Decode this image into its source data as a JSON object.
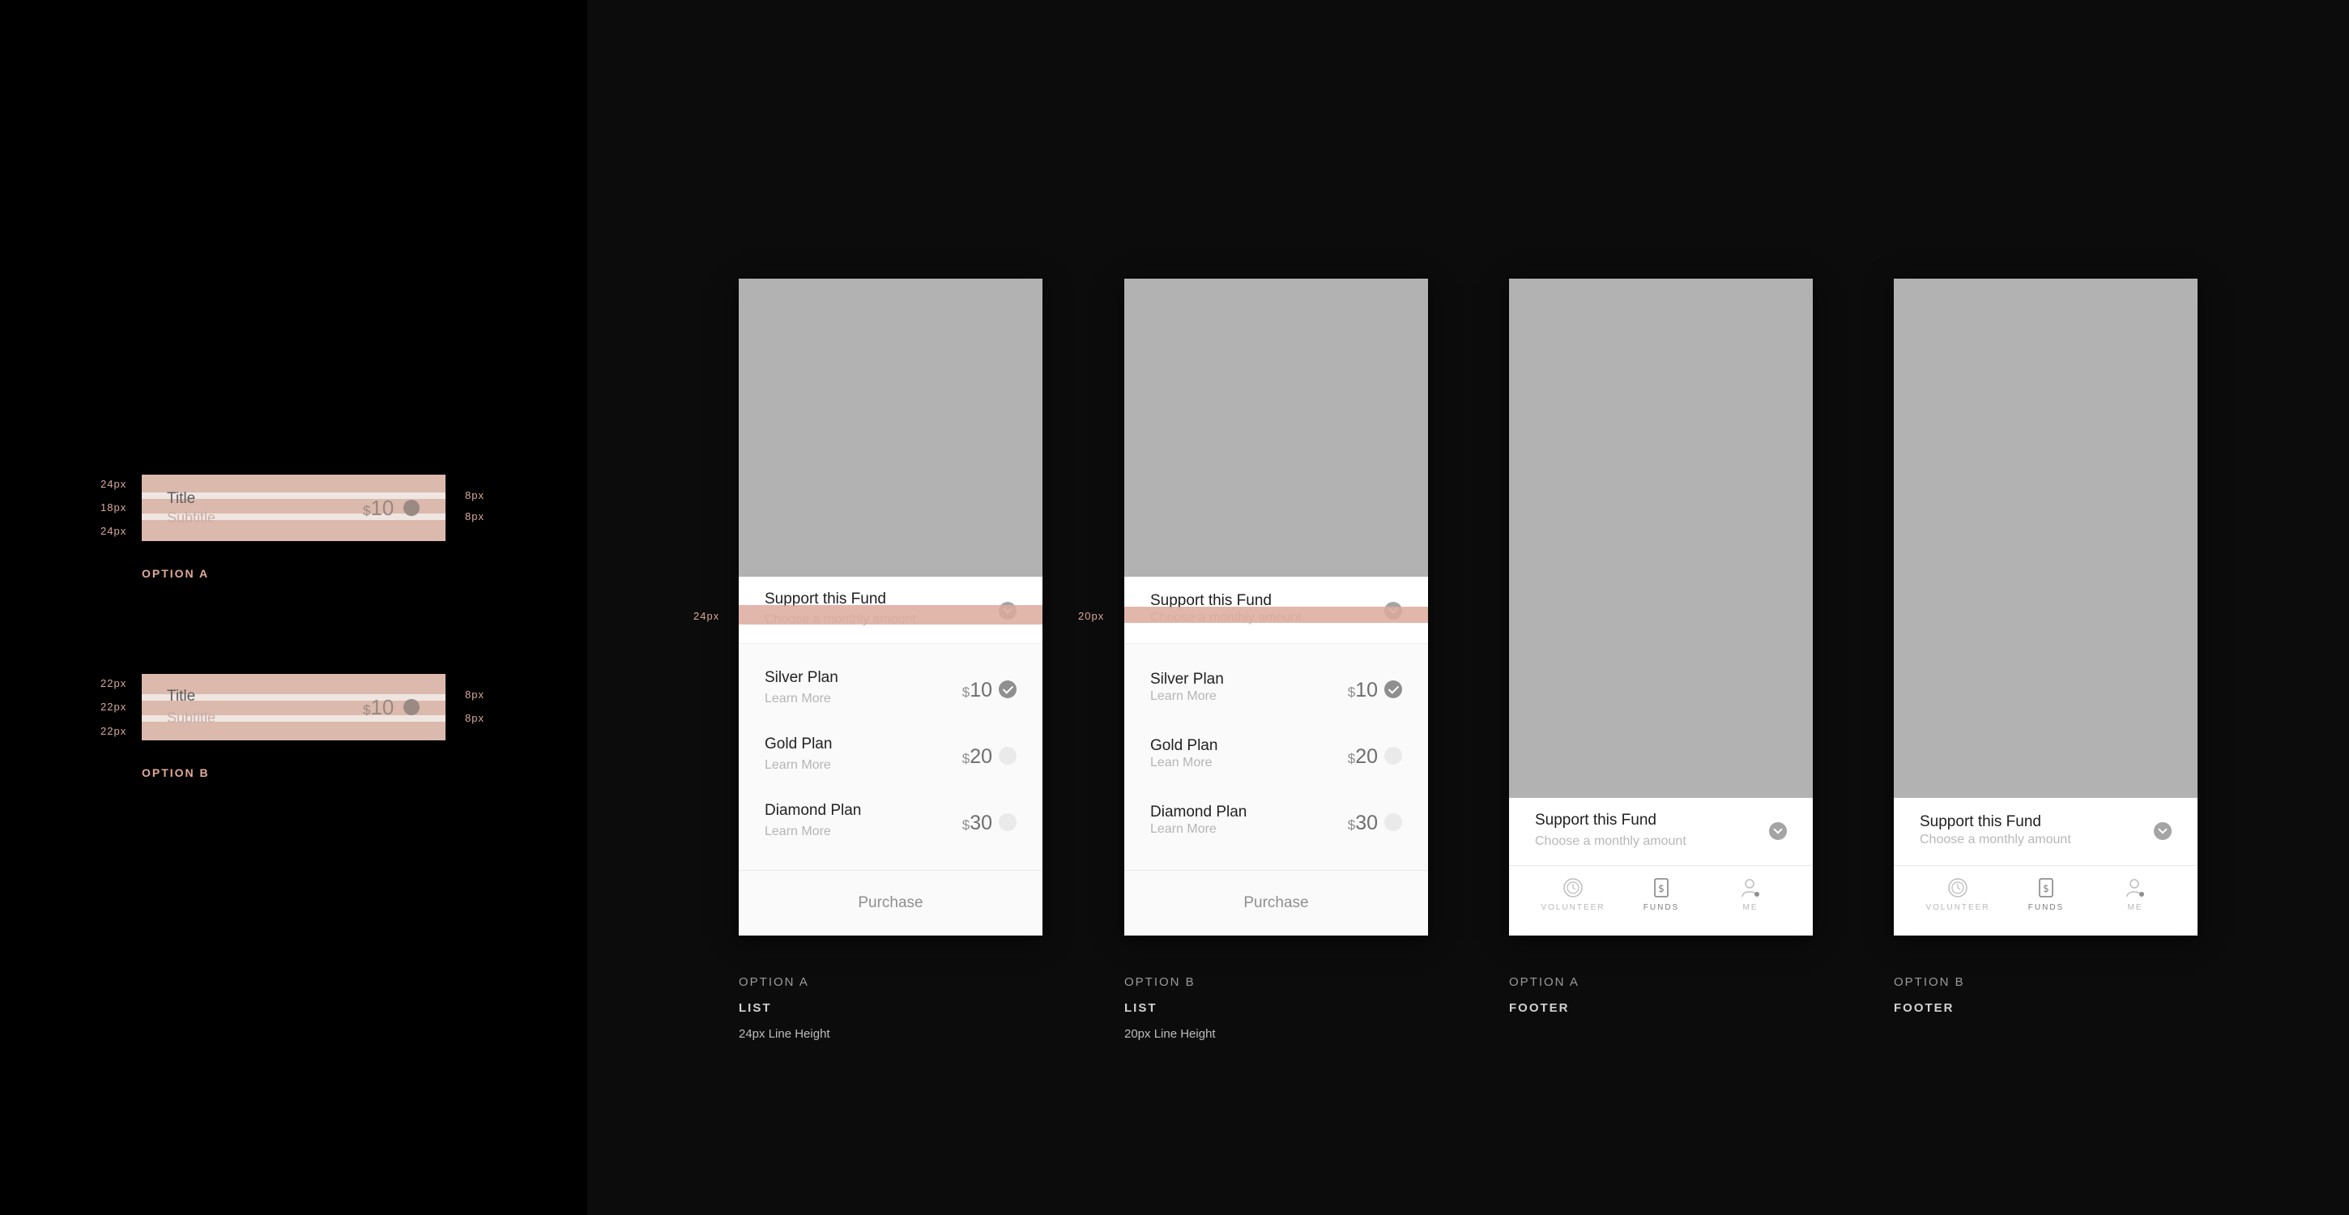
{
  "spec": {
    "option_a": {
      "label": "OPTION A",
      "left_measures": [
        "24px",
        "18px",
        "24px"
      ],
      "right_measures": [
        "8px",
        "8px"
      ],
      "title": "Title",
      "subtitle": "Subtitle",
      "currency": "$",
      "price": "10"
    },
    "option_b": {
      "label": "OPTION B",
      "left_measures": [
        "22px",
        "22px",
        "22px"
      ],
      "right_measures": [
        "8px",
        "8px"
      ],
      "title": "Title",
      "subtitle": "Subtitle",
      "currency": "$",
      "price": "10"
    }
  },
  "screens": [
    {
      "line_height_marker": "24px",
      "fund_title": "Support this Fund",
      "fund_subtitle": "Choose a monthly amount",
      "plans": [
        {
          "name": "Silver Plan",
          "more": "Learn More",
          "currency": "$",
          "price": "10",
          "selected": true
        },
        {
          "name": "Gold Plan",
          "more": "Learn More",
          "currency": "$",
          "price": "20",
          "selected": false
        },
        {
          "name": "Diamond Plan",
          "more": "Learn More",
          "currency": "$",
          "price": "30",
          "selected": false
        }
      ],
      "purchase_label": "Purchase",
      "caption_option": "OPTION A",
      "caption_type": "LIST",
      "caption_note": "24px Line Height"
    },
    {
      "line_height_marker": "20px",
      "fund_title": "Support this Fund",
      "fund_subtitle": "Choose a monthly amount",
      "plans": [
        {
          "name": "Silver Plan",
          "more": "Learn More",
          "currency": "$",
          "price": "10",
          "selected": true
        },
        {
          "name": "Gold Plan",
          "more": "Lean More",
          "currency": "$",
          "price": "20",
          "selected": false
        },
        {
          "name": "Diamond Plan",
          "more": "Learn More",
          "currency": "$",
          "price": "30",
          "selected": false
        }
      ],
      "purchase_label": "Purchase",
      "caption_option": "OPTION B",
      "caption_type": "LIST",
      "caption_note": "20px Line Height"
    },
    {
      "fund_title": "Support this Fund",
      "fund_subtitle": "Choose a monthly amount",
      "tabs": [
        {
          "label": "VOLUNTEER",
          "icon": "clock-icon"
        },
        {
          "label": "FUNDS",
          "icon": "dollar-document-icon"
        },
        {
          "label": "ME",
          "icon": "person-icon"
        }
      ],
      "caption_option": "OPTION A",
      "caption_type": "FOOTER"
    },
    {
      "fund_title": "Support this Fund",
      "fund_subtitle": "Choose a monthly amount",
      "tabs": [
        {
          "label": "VOLUNTEER",
          "icon": "clock-icon"
        },
        {
          "label": "FUNDS",
          "icon": "dollar-document-icon"
        },
        {
          "label": "ME",
          "icon": "person-icon"
        }
      ],
      "caption_option": "OPTION B",
      "caption_type": "FOOTER"
    }
  ],
  "colors": {
    "left_pane": "#000000",
    "canvas": "#0c0c0c",
    "hero_placeholder": "#b2b2b2",
    "annotation_pink": "#dcb9ad",
    "measure_text": "#d8a89a"
  }
}
